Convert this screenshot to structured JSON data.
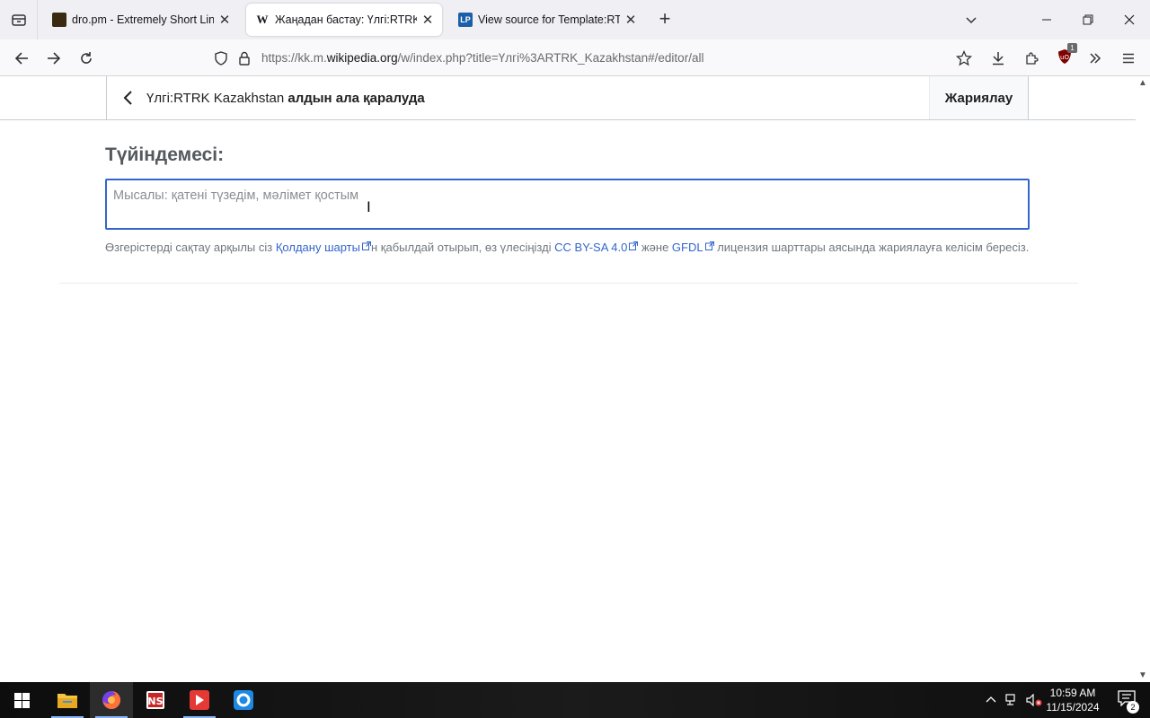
{
  "browser": {
    "tabs": [
      {
        "title": "dro.pm - Extremely Short Links",
        "favicon": "dro-pm-icon",
        "active": false
      },
      {
        "title": "Жаңадан бастау: Үлгі:RTRK Kazakhstan",
        "favicon": "W",
        "active": true
      },
      {
        "title": "View source for Template:RTRK",
        "favicon": "LP",
        "active": false
      }
    ],
    "new_tab": "+",
    "url": {
      "prefix": "https://kk.m.",
      "domain": "wikipedia.org",
      "suffix": "/w/index.php?title=Үлгі%3ARTRK_Kazakhstan#/editor/all"
    },
    "extension_badge": "1"
  },
  "editor": {
    "title_page": "Үлгі:RTRK Kazakhstan",
    "title_mode": "алдын ала қаралуда",
    "publish_label": "Жариялау",
    "summary_label": "Түйіндемесі:",
    "summary_placeholder": "Мысалы: қатені түзедім, мәлімет қостым",
    "summary_value": "",
    "license": {
      "part1": "Өзгерістерді сақтау арқылы сіз ",
      "terms_link": "Қолдану шарты",
      "part2": "н қабылдай отырып, өз үлесіңізді ",
      "ccbysa_link": "CC BY-SA 4.0",
      "part3": " және ",
      "gfdl_link": "GFDL",
      "part4": " лицензия шарттары аясында жариялауға келісім бересіз."
    }
  },
  "taskbar": {
    "time": "10:59 AM",
    "date": "11/15/2024",
    "notification_count": "2"
  },
  "colors": {
    "link": "#3366cc",
    "focus_border": "#3366cc",
    "taskbar_active_underline": "#8ab4f8"
  }
}
